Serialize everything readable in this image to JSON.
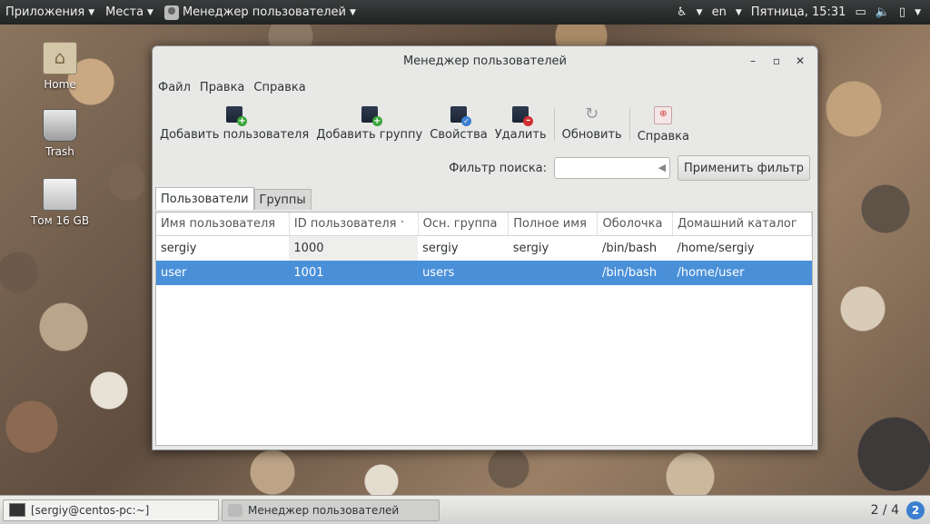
{
  "topbar": {
    "apps_label": "Приложения",
    "places_label": "Места",
    "active_app_label": "Менеджер пользователей",
    "lang": "en",
    "clock": "Пятница, 15:31"
  },
  "desktop": {
    "icons": [
      {
        "label": "Home"
      },
      {
        "label": "Trash"
      },
      {
        "label": "Том 16 GB"
      }
    ]
  },
  "window": {
    "title": "Менеджер пользователей",
    "menu": [
      "Файл",
      "Правка",
      "Справка"
    ],
    "toolbar": {
      "add_user": "Добавить пользователя",
      "add_group": "Добавить группу",
      "properties": "Свойства",
      "delete": "Удалить",
      "refresh": "Обновить",
      "help": "Справка"
    },
    "filter": {
      "label": "Фильтр поиска:",
      "value": "",
      "apply": "Применить фильтр"
    },
    "tabs": [
      "Пользователи",
      "Группы"
    ],
    "table": {
      "columns": [
        "Имя пользователя",
        "ID пользователя",
        "Осн. группа",
        "Полное имя",
        "Оболочка",
        "Домашний каталог"
      ],
      "rows": [
        {
          "username": "sergiy",
          "uid": "1000",
          "group": "sergiy",
          "fullname": "sergiy",
          "shell": "/bin/bash",
          "home": "/home/sergiy"
        },
        {
          "username": "user",
          "uid": "1001",
          "group": "users",
          "fullname": "",
          "shell": "/bin/bash",
          "home": "/home/user"
        }
      ]
    }
  },
  "bottombar": {
    "task1": "[sergiy@centos-pc:~]",
    "task2": "Менеджер пользователей",
    "workspace": "2 / 4",
    "notif_count": "2"
  }
}
